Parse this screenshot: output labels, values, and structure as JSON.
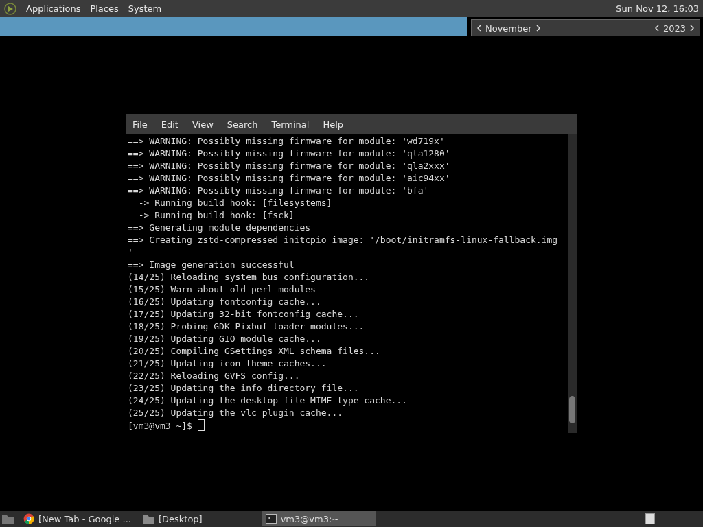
{
  "top_panel": {
    "menus": [
      "Applications",
      "Places",
      "System"
    ],
    "clock": "Sun Nov 12, 16:03"
  },
  "calendar": {
    "month": "November",
    "year": "2023"
  },
  "terminal": {
    "menus": [
      "File",
      "Edit",
      "View",
      "Search",
      "Terminal",
      "Help"
    ],
    "lines": [
      "==> WARNING: Possibly missing firmware for module: 'wd719x'",
      "==> WARNING: Possibly missing firmware for module: 'qla1280'",
      "==> WARNING: Possibly missing firmware for module: 'qla2xxx'",
      "==> WARNING: Possibly missing firmware for module: 'aic94xx'",
      "==> WARNING: Possibly missing firmware for module: 'bfa'",
      "  -> Running build hook: [filesystems]",
      "  -> Running build hook: [fsck]",
      "==> Generating module dependencies",
      "==> Creating zstd-compressed initcpio image: '/boot/initramfs-linux-fallback.img",
      "'",
      "==> Image generation successful",
      "(14/25) Reloading system bus configuration...",
      "(15/25) Warn about old perl modules",
      "(16/25) Updating fontconfig cache...",
      "(17/25) Updating 32-bit fontconfig cache...",
      "(18/25) Probing GDK-Pixbuf loader modules...",
      "(19/25) Updating GIO module cache...",
      "(20/25) Compiling GSettings XML schema files...",
      "(21/25) Updating icon theme caches...",
      "(22/25) Reloading GVFS config...",
      "(23/25) Updating the info directory file...",
      "(24/25) Updating the desktop file MIME type cache...",
      "(25/25) Updating the vlc plugin cache..."
    ],
    "prompt": "[vm3@vm3 ~]$"
  },
  "taskbar": {
    "items": [
      {
        "kind": "browser",
        "label": "[New Tab - Google ...",
        "selected": false
      },
      {
        "kind": "folder",
        "label": "[Desktop]",
        "selected": false
      },
      {
        "kind": "terminal",
        "label": "vm3@vm3:~",
        "selected": true
      }
    ]
  }
}
